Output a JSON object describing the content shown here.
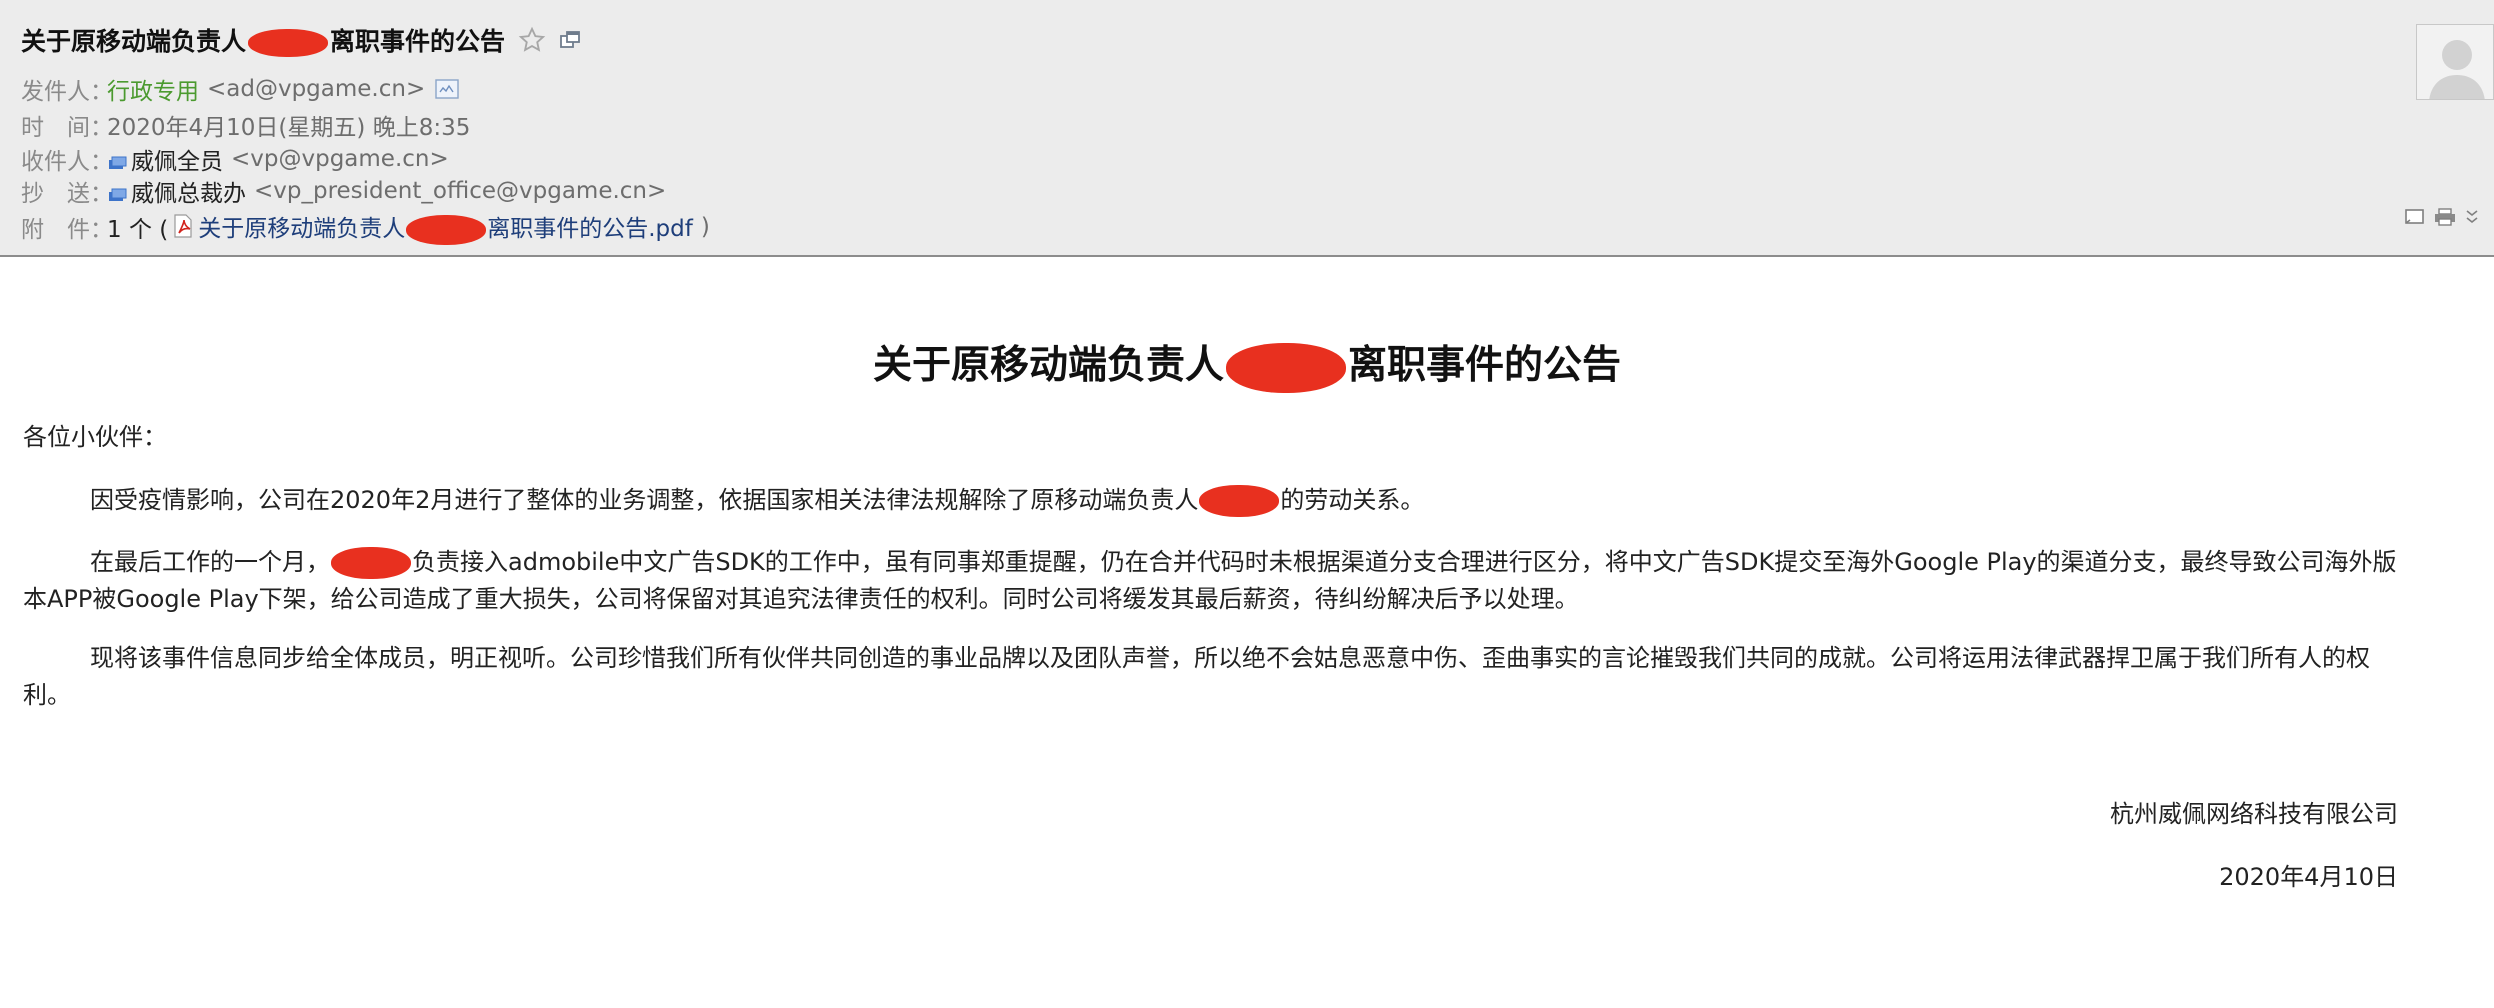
{
  "header": {
    "subject_before": "关于原移动端负责人",
    "subject_after": "离职事件的公告",
    "from_label": "发件人：",
    "from_name": "行政专用",
    "from_addr": "<ad@vpgame.cn>",
    "time_label": "时　间：",
    "time_value": "2020年4月10日(星期五) 晚上8:35",
    "to_label": "收件人：",
    "to_name": "威佩全员",
    "to_addr": "<vp@vpgame.cn>",
    "cc_label": "抄　送：",
    "cc_name": "威佩总裁办",
    "cc_addr": "<vp_president_office@vpgame.cn>",
    "att_label": "附　件：",
    "att_count": "1 个 (",
    "att_before": "关于原移动端负责人",
    "att_after": "离职事件的公告.pdf",
    "att_close": ")"
  },
  "body": {
    "title_before": "关于原移动端负责人",
    "title_after": "离职事件的公告",
    "greeting": "各位小伙伴：",
    "p1_before": "因受疫情影响，公司在2020年2月进行了整体的业务调整，依据国家相关法律法规解除了原移动端负责人",
    "p1_after": "的劳动关系。",
    "p2_before": "在最后工作的一个月，",
    "p2_after": "负责接入admobile中文广告SDK的工作中，虽有同事郑重提醒，仍在合并代码时未根据渠道分支合理进行区分，将中文广告SDK提交至海外Google Play的渠道分支，最终导致公司海外版本APP被Google Play下架，给公司造成了重大损失，公司将保留对其追究法律责任的权利。同时公司将缓发其最后薪资，待纠纷解决后予以处理。",
    "p3": "现将该事件信息同步给全体成员，明正视听。公司珍惜我们所有伙伴共同创造的事业品牌以及团队声誉，所以绝不会姑息恶意中伤、歪曲事实的言论摧毁我们共同的成就。公司将运用法律武器捍卫属于我们所有人的权利。",
    "signature": "杭州威佩网络科技有限公司",
    "date": "2020年4月10日"
  },
  "icons": {
    "star": "star-icon",
    "popout": "popout-window-icon",
    "vcard": "vcard-icon",
    "contact": "contact-group-icon",
    "pdf": "pdf-file-icon",
    "avatar": "avatar-placeholder",
    "tools": [
      "view-source-icon",
      "print-icon",
      "expand-chevron-icon"
    ]
  },
  "colors": {
    "header_bg": "#ececec",
    "sender_green": "#4b9a2f",
    "link_blue": "#1e3e7a",
    "redaction_red": "#e8301f"
  }
}
